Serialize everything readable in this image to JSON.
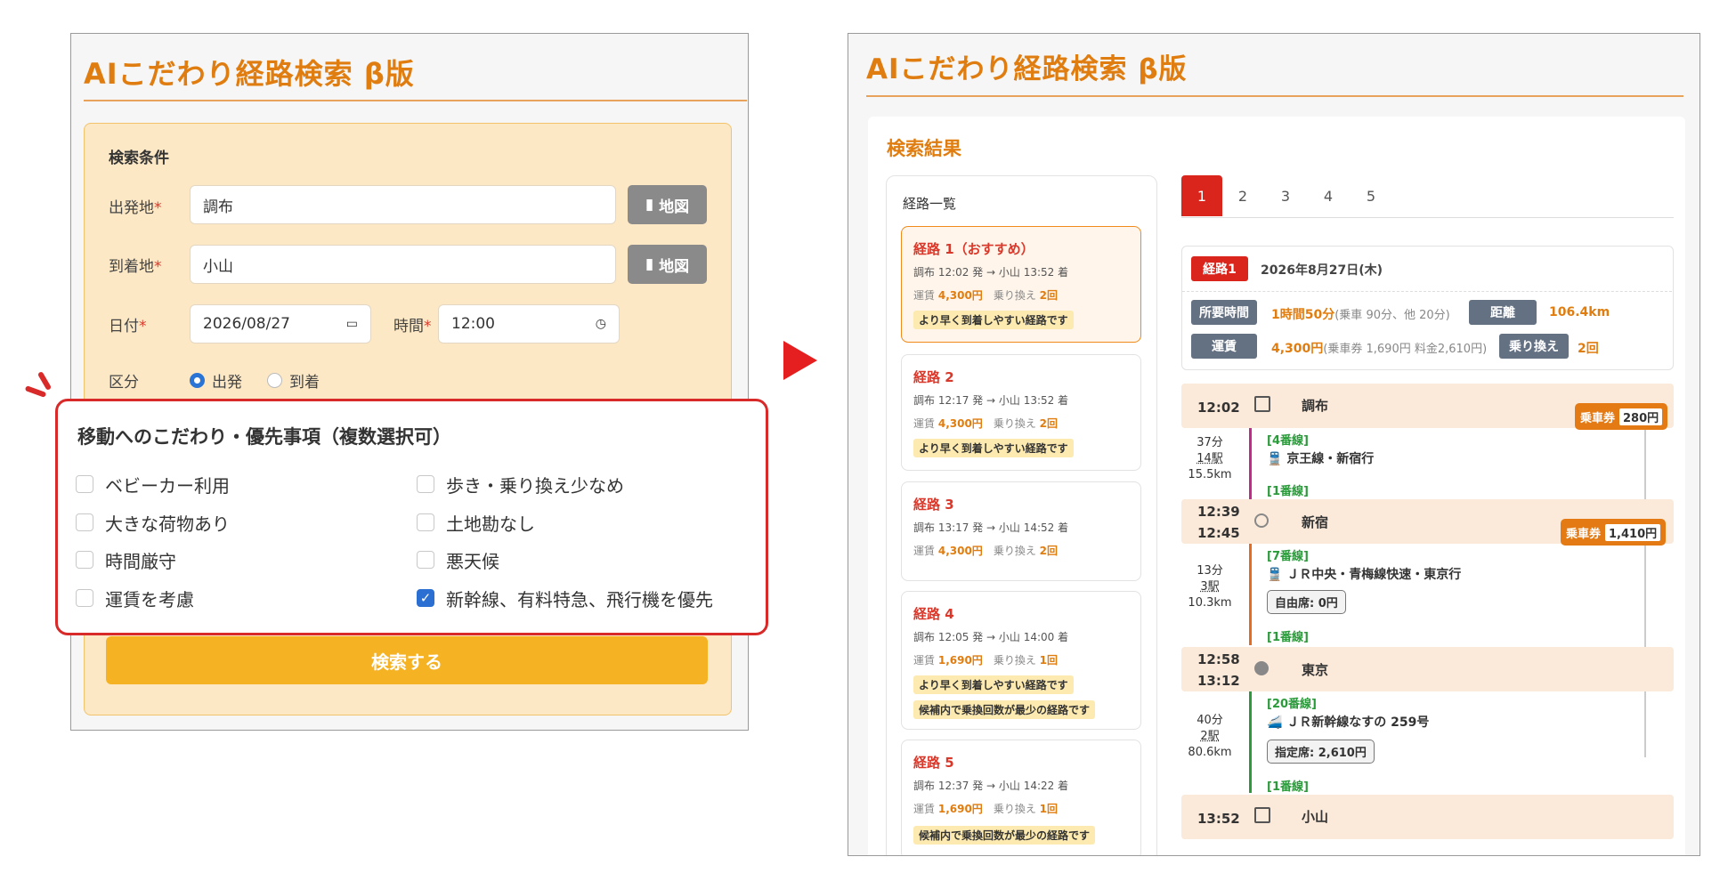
{
  "left": {
    "title": "AIこだわり経路検索 β版",
    "conditions_title": "検索条件",
    "origin_label": "出発地",
    "origin_value": "調布",
    "dest_label": "到着地",
    "dest_value": "小山",
    "map_label": "地図",
    "date_label": "日付",
    "date_value": "2026/08/27",
    "time_label": "時間",
    "time_value": "12:00",
    "required_mark": "*",
    "kind_label": "区分",
    "kind_options": [
      "出発",
      "到着"
    ],
    "kind_selected": "出発",
    "prefs_title": "移動へのこだわり・優先事項（複数選択可）",
    "prefs": [
      {
        "label": "ベビーカー利用",
        "checked": false
      },
      {
        "label": "歩き・乗り換え少なめ",
        "checked": false
      },
      {
        "label": "大きな荷物あり",
        "checked": false
      },
      {
        "label": "土地勘なし",
        "checked": false
      },
      {
        "label": "時間厳守",
        "checked": false
      },
      {
        "label": "悪天候",
        "checked": false
      },
      {
        "label": "運賃を考慮",
        "checked": false
      },
      {
        "label": "新幹線、有料特急、飛行機を優先",
        "checked": true
      }
    ],
    "search_button": "検索する"
  },
  "right": {
    "title": "AIこだわり経路検索 β版",
    "results_title": "検索結果",
    "list_title": "経路一覧",
    "routes": [
      {
        "title": "経路 1（おすすめ）",
        "route": "調布 12:02 発 → 小山 13:52 着",
        "fare": "4,300円",
        "transfers": "2回",
        "badges": [
          "より早く到着しやすい経路です"
        ]
      },
      {
        "title": "経路 2",
        "route": "調布 12:17 発 → 小山 13:52 着",
        "fare": "4,300円",
        "transfers": "2回",
        "badges": [
          "より早く到着しやすい経路です"
        ]
      },
      {
        "title": "経路 3",
        "route": "調布 13:17 発 → 小山 14:52 着",
        "fare": "4,300円",
        "transfers": "2回",
        "badges": []
      },
      {
        "title": "経路 4",
        "route": "調布 12:05 発 → 小山 14:00 着",
        "fare": "1,690円",
        "transfers": "1回",
        "badges": [
          "より早く到着しやすい経路です",
          "候補内で乗換回数が最少の経路です"
        ]
      },
      {
        "title": "経路 5",
        "route": "調布 12:37 発 → 小山 14:22 着",
        "fare": "1,690円",
        "transfers": "1回",
        "badges": [
          "候補内で乗換回数が最少の経路です"
        ]
      }
    ],
    "fare_label": "運賃",
    "transfer_label": "乗り換え",
    "tabs": [
      "1",
      "2",
      "3",
      "4",
      "5"
    ],
    "active_tab": "1",
    "summary": {
      "route_label": "経路1",
      "date": "2026年8月27日(木)",
      "duration_label": "所要時間",
      "duration_value": "1時間50分",
      "duration_detail": "(乗車 90分、他 20分)",
      "distance_label": "距離",
      "distance_value": "106.4km",
      "fare_label": "運賃",
      "fare_value": "4,300円",
      "fare_detail": "(乗車券 1,690円 料金2,610円)",
      "transfer_label": "乗り換え",
      "transfer_value": "2回"
    },
    "timeline": {
      "stations": [
        {
          "times": [
            "12:02"
          ],
          "name": "調布"
        },
        {
          "times": [
            "12:39",
            "12:45"
          ],
          "name": "新宿"
        },
        {
          "times": [
            "12:58",
            "13:12"
          ],
          "name": "東京"
        },
        {
          "times": [
            "13:52"
          ],
          "name": "小山"
        }
      ],
      "segments": [
        {
          "platform_from": "[4番線]",
          "line": "京王線・新宿行",
          "duration": "37分",
          "stops": "14駅",
          "distance": "15.5km",
          "platform_to": "[1番線]",
          "seat": "",
          "color": "#c2298a"
        },
        {
          "platform_from": "[7番線]",
          "line": "ＪＲ中央・青梅線快速・東京行",
          "duration": "13分",
          "stops": "3駅",
          "distance": "10.3km",
          "platform_to": "[1番線]",
          "seat": "自由席: 0円",
          "color": "#e86a1c"
        },
        {
          "platform_from": "[20番線]",
          "line": "ＪＲ新幹線なすの 259号",
          "duration": "40分",
          "stops": "2駅",
          "distance": "80.6km",
          "platform_to": "[1番線]",
          "seat": "指定席: 2,610円",
          "color": "#2a9a3a"
        }
      ],
      "tickets": [
        {
          "label": "乗車券",
          "value": "280円"
        },
        {
          "label": "乗車券",
          "value": "1,410円"
        }
      ]
    }
  },
  "colors": {
    "accent": "#e07d10",
    "highlight": "#d92a2a",
    "button": "#f5b223"
  }
}
